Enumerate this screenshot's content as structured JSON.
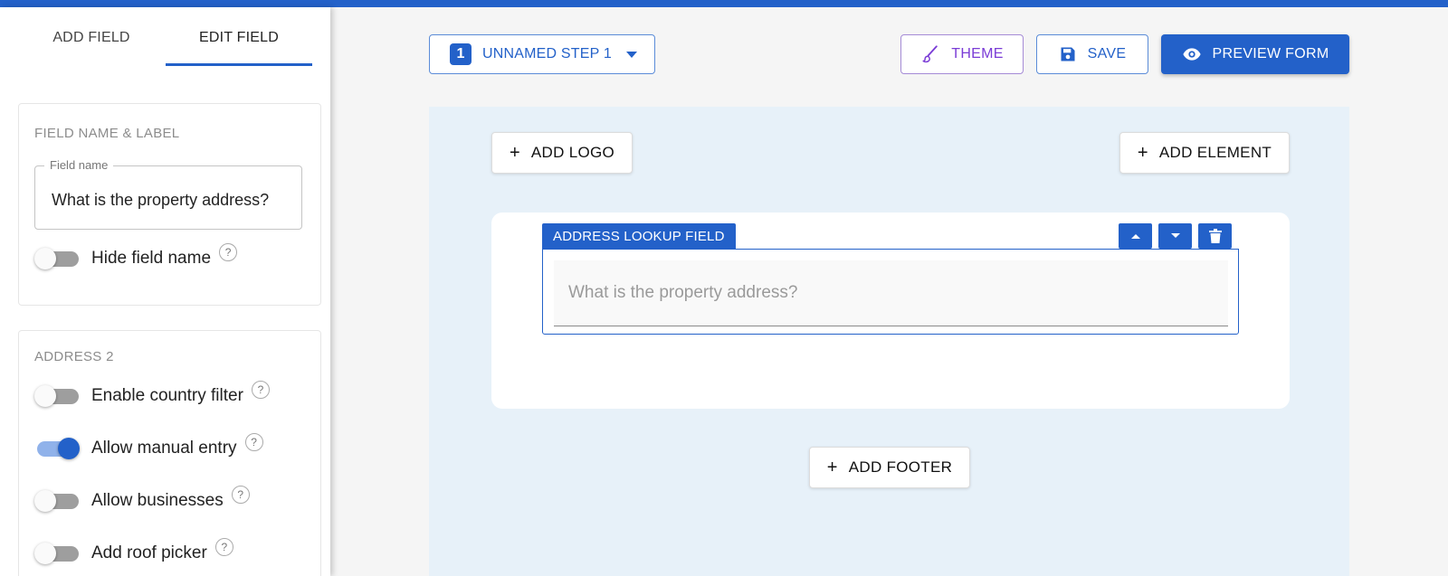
{
  "sidebar": {
    "tabs": [
      {
        "label": "ADD FIELD",
        "active": false
      },
      {
        "label": "EDIT FIELD",
        "active": true
      }
    ],
    "field_card": {
      "title": "FIELD NAME & LABEL",
      "field_name_label": "Field name",
      "field_name_value": "What is the property address?",
      "hide_field_name": {
        "label": "Hide field name",
        "on": false,
        "help": "?"
      }
    },
    "address_card": {
      "title": "ADDRESS 2",
      "toggles": [
        {
          "label": "Enable country filter",
          "on": false,
          "help": "?"
        },
        {
          "label": "Allow manual entry",
          "on": true,
          "help": "?"
        },
        {
          "label": "Allow businesses",
          "on": false,
          "help": "?"
        },
        {
          "label": "Add roof picker",
          "on": false,
          "help": "?"
        }
      ]
    }
  },
  "toolbar": {
    "step_number": "1",
    "step_label": "UNNAMED STEP 1",
    "theme_label": "THEME",
    "save_label": "SAVE",
    "preview_label": "PREVIEW FORM"
  },
  "canvas": {
    "add_logo_label": "ADD LOGO",
    "add_element_label": "ADD ELEMENT",
    "add_footer_label": "ADD FOOTER",
    "plus": "+",
    "field": {
      "type_label": "ADDRESS LOOKUP FIELD",
      "placeholder": "What is the property address?"
    }
  },
  "colors": {
    "accent": "#2361c9",
    "theme_purple": "#7a3cd6",
    "canvas_bg": "#e7f1f9"
  },
  "icons": [
    "brush-icon",
    "save-icon",
    "eye-icon",
    "chevron-down-icon",
    "arrow-up-icon",
    "arrow-down-icon",
    "trash-icon",
    "plus-icon",
    "help-icon"
  ]
}
